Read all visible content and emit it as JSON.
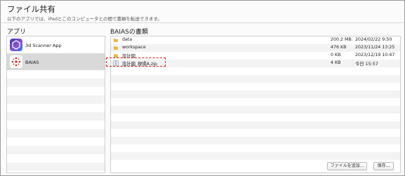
{
  "header": {
    "title": "ファイル共有",
    "subtitle": "以下のアプリでは、iPadとこのコンピュータとの間で書類を転送できます。"
  },
  "apps": {
    "heading": "アプリ",
    "items": [
      {
        "label": "3d Scanner App",
        "icon": "3d-scanner-app-icon"
      },
      {
        "label": "BAIAS",
        "icon": "baias-app-icon",
        "selected": true
      }
    ]
  },
  "documents": {
    "heading": "BAIASの書類",
    "files": [
      {
        "name": "data",
        "size": "200.2 MB",
        "date": "2024/02/22 9:50",
        "icon": "folder-icon"
      },
      {
        "name": "workspace",
        "size": "476 KB",
        "date": "2023/11/24 13:25",
        "icon": "folder-icon"
      },
      {
        "name": "設計図",
        "size": "0 KB",
        "date": "2023/12/19 10:47",
        "icon": "folder-icon"
      },
      {
        "name": "設計図_現場A.zip",
        "size": "4 KB",
        "date": "今日 15:57",
        "icon": "zip-file-icon"
      }
    ]
  },
  "buttons": {
    "add_file": "ファイルを追加...",
    "save": "保存..."
  },
  "colors": {
    "highlight": "#e0201b",
    "folder": "#e8b84a",
    "selected_row": "#d9d9d9"
  }
}
